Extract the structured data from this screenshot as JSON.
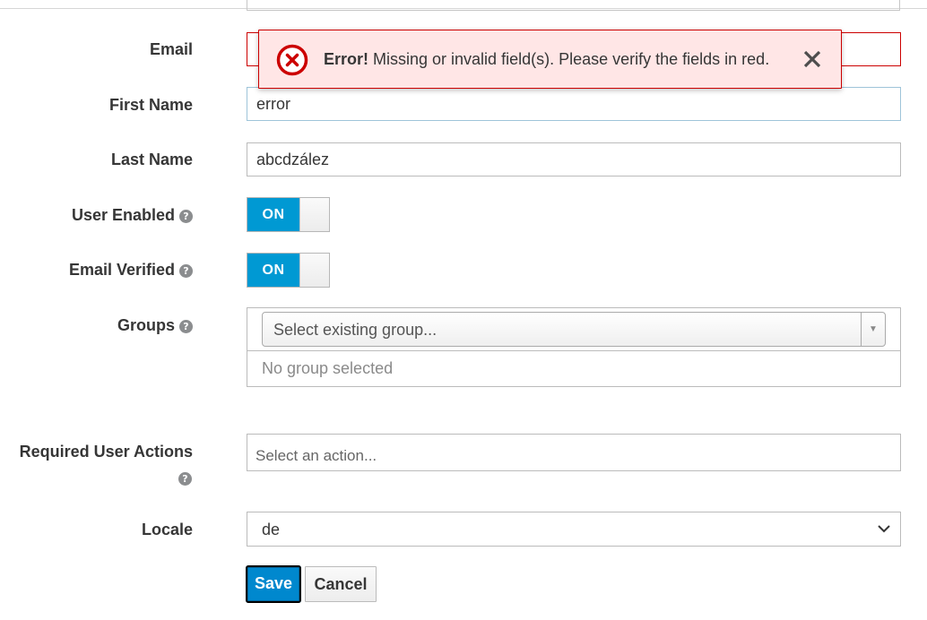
{
  "form": {
    "email": {
      "label": "Email",
      "value": "",
      "state": "error"
    },
    "first_name": {
      "label": "First Name",
      "value": "error"
    },
    "last_name": {
      "label": "Last Name",
      "value": "abcdzález"
    },
    "user_enabled": {
      "label": "User Enabled",
      "toggle_text": "ON",
      "on": true
    },
    "email_verified": {
      "label": "Email Verified",
      "toggle_text": "ON",
      "on": true
    },
    "groups": {
      "label": "Groups",
      "placeholder": "Select existing group...",
      "empty_text": "No group selected"
    },
    "required_actions": {
      "label": "Required User Actions",
      "placeholder": "Select an action..."
    },
    "locale": {
      "label": "Locale",
      "value": "de"
    },
    "help_icon_glyph": "?"
  },
  "actions": {
    "save_label": "Save",
    "cancel_label": "Cancel"
  },
  "alert": {
    "title": "Error!",
    "message": " Missing or invalid field(s). Please verify the fields in red.",
    "icon": "error-circle-icon",
    "close_icon": "close-icon"
  },
  "colors": {
    "accent": "#0099d3",
    "primary_button": "#0088ce",
    "error": "#cc0000",
    "alert_bg": "#ffe6e6"
  }
}
